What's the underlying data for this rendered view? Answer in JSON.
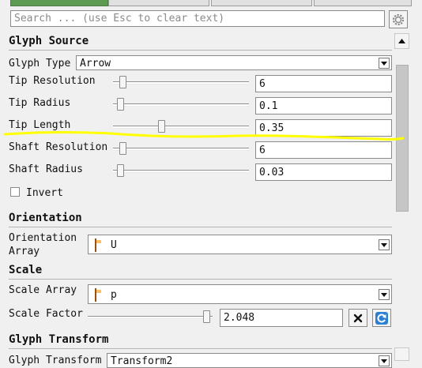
{
  "search": {
    "placeholder": "Search ... (use Esc to clear text)"
  },
  "sections": {
    "glyph_source": "Glyph Source",
    "orientation": "Orientation",
    "scale": "Scale",
    "glyph_transform": "Glyph Transform"
  },
  "glyph_type": {
    "label": "Glyph Type",
    "value": "Arrow"
  },
  "tip_resolution": {
    "label": "Tip Resolution",
    "value": "6",
    "slider_fraction": 0.05
  },
  "tip_radius": {
    "label": "Tip Radius",
    "value": "0.1",
    "slider_fraction": 0.03
  },
  "tip_length": {
    "label": "Tip Length",
    "value": "0.35",
    "slider_fraction": 0.35
  },
  "shaft_resolution": {
    "label": "Shaft Resolution",
    "value": "6",
    "slider_fraction": 0.05
  },
  "shaft_radius": {
    "label": "Shaft Radius",
    "value": "0.03",
    "slider_fraction": 0.03
  },
  "invert": {
    "label": "Invert",
    "checked": false
  },
  "orientation_array": {
    "label_line1": "Orientation",
    "label_line2": "Array",
    "value": "U"
  },
  "scale_array": {
    "label": "Scale Array",
    "value": "p"
  },
  "scale_factor": {
    "label": "Scale Factor",
    "value": "2.048",
    "slider_fraction": 0.98
  },
  "glyph_transform": {
    "label": "Glyph Transform",
    "value": "Transform2"
  },
  "colors": {
    "highlight": "#ffff00",
    "array_icon": "#e58a1e",
    "active_tab": "#5d9a52",
    "refresh_icon": "#2d7fd2"
  },
  "icons": [
    "gear-icon",
    "chevron-down-icon",
    "array-cube-icon",
    "clear-x-icon",
    "refresh-icon",
    "scroll-up-icon"
  ]
}
